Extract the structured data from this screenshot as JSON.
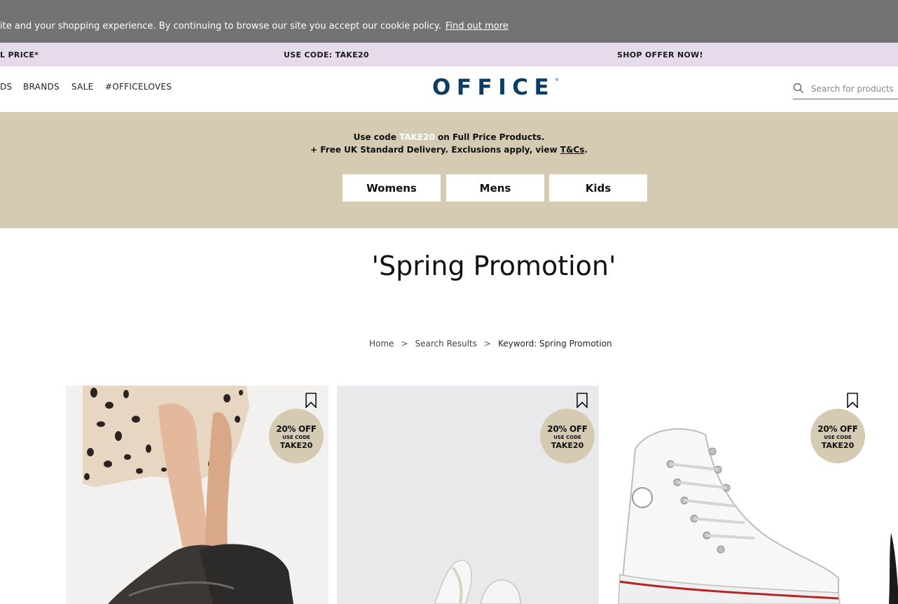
{
  "cookie_bar": {
    "text": "ite and your shopping experience. By continuing to browse our site you accept our cookie policy.",
    "link": "Find out more"
  },
  "promo_strip": {
    "items": [
      "L PRICE*",
      "USE CODE: TAKE20",
      "SHOP OFFER NOW!"
    ]
  },
  "header": {
    "nav": [
      "DS",
      "BRANDS",
      "SALE",
      "#OFFICELOVES"
    ],
    "logo": "OFFICE",
    "logo_mark": "®",
    "search": {
      "placeholder": "Search for products"
    }
  },
  "banner": {
    "line1_prefix": "Use code ",
    "line1_code": "TAKE20",
    "line1_suffix": " on Full Price Products.",
    "line2_prefix": "+ Free UK Standard Delivery. Exclusions apply, view ",
    "line2_link": "T&Cs",
    "line2_suffix": ".",
    "buttons": [
      "Womens",
      "Mens",
      "Kids"
    ]
  },
  "page_title": "'Spring Promotion'",
  "breadcrumb": {
    "items": [
      "Home",
      "Search Results",
      "Keyword: Spring Promotion"
    ],
    "separator": ">"
  },
  "products": [
    {
      "badge_main": "20% OFF",
      "badge_sub": "USE CODE",
      "badge_code": "TAKE20"
    },
    {
      "badge_main": "20% OFF",
      "badge_sub": "USE CODE",
      "badge_code": "TAKE20"
    },
    {
      "badge_main": "20% OFF",
      "badge_sub": "USE CODE",
      "badge_code": "TAKE20"
    }
  ],
  "colors": {
    "cookie_bg": "#737373",
    "promo_bg": "#e6dbea",
    "banner_bg": "#d5cbb3",
    "logo": "#0b3d66"
  }
}
